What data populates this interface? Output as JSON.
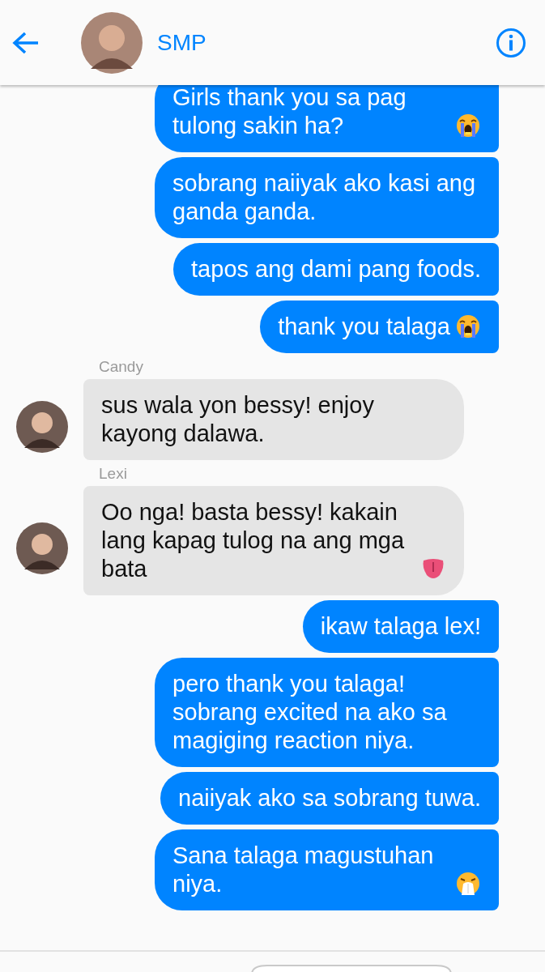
{
  "header": {
    "title": "SMP"
  },
  "messages": [
    {
      "kind": "outgoing",
      "text": "Girls thank you sa pag tulong sakin ha?",
      "emoji": {
        "kind": "crying"
      }
    },
    {
      "kind": "outgoing",
      "text": "sobrang naiiyak ako kasi ang ganda ganda."
    },
    {
      "kind": "outgoing",
      "text": "tapos ang dami pang foods."
    },
    {
      "kind": "outgoing",
      "text": "thank you talaga",
      "emoji": {
        "kind": "crying"
      }
    },
    {
      "kind": "incoming",
      "sender": "Candy",
      "text": "sus wala yon bessy! enjoy kayong dalawa."
    },
    {
      "kind": "incoming",
      "sender": "Lexi",
      "text": "Oo nga! basta bessy! kakain lang kapag tulog na ang mga bata",
      "emoji": {
        "kind": "tongue"
      }
    },
    {
      "kind": "outgoing",
      "text": "ikaw talaga lex!"
    },
    {
      "kind": "outgoing",
      "text": "pero thank you talaga! sobrang excited na ako sa magiging reaction niya."
    },
    {
      "kind": "outgoing",
      "text": "naiiyak ako sa sobrang tuwa."
    },
    {
      "kind": "outgoing",
      "text": "Sana talaga magustuhan niya.",
      "emoji": {
        "kind": "sneezing"
      }
    }
  ]
}
